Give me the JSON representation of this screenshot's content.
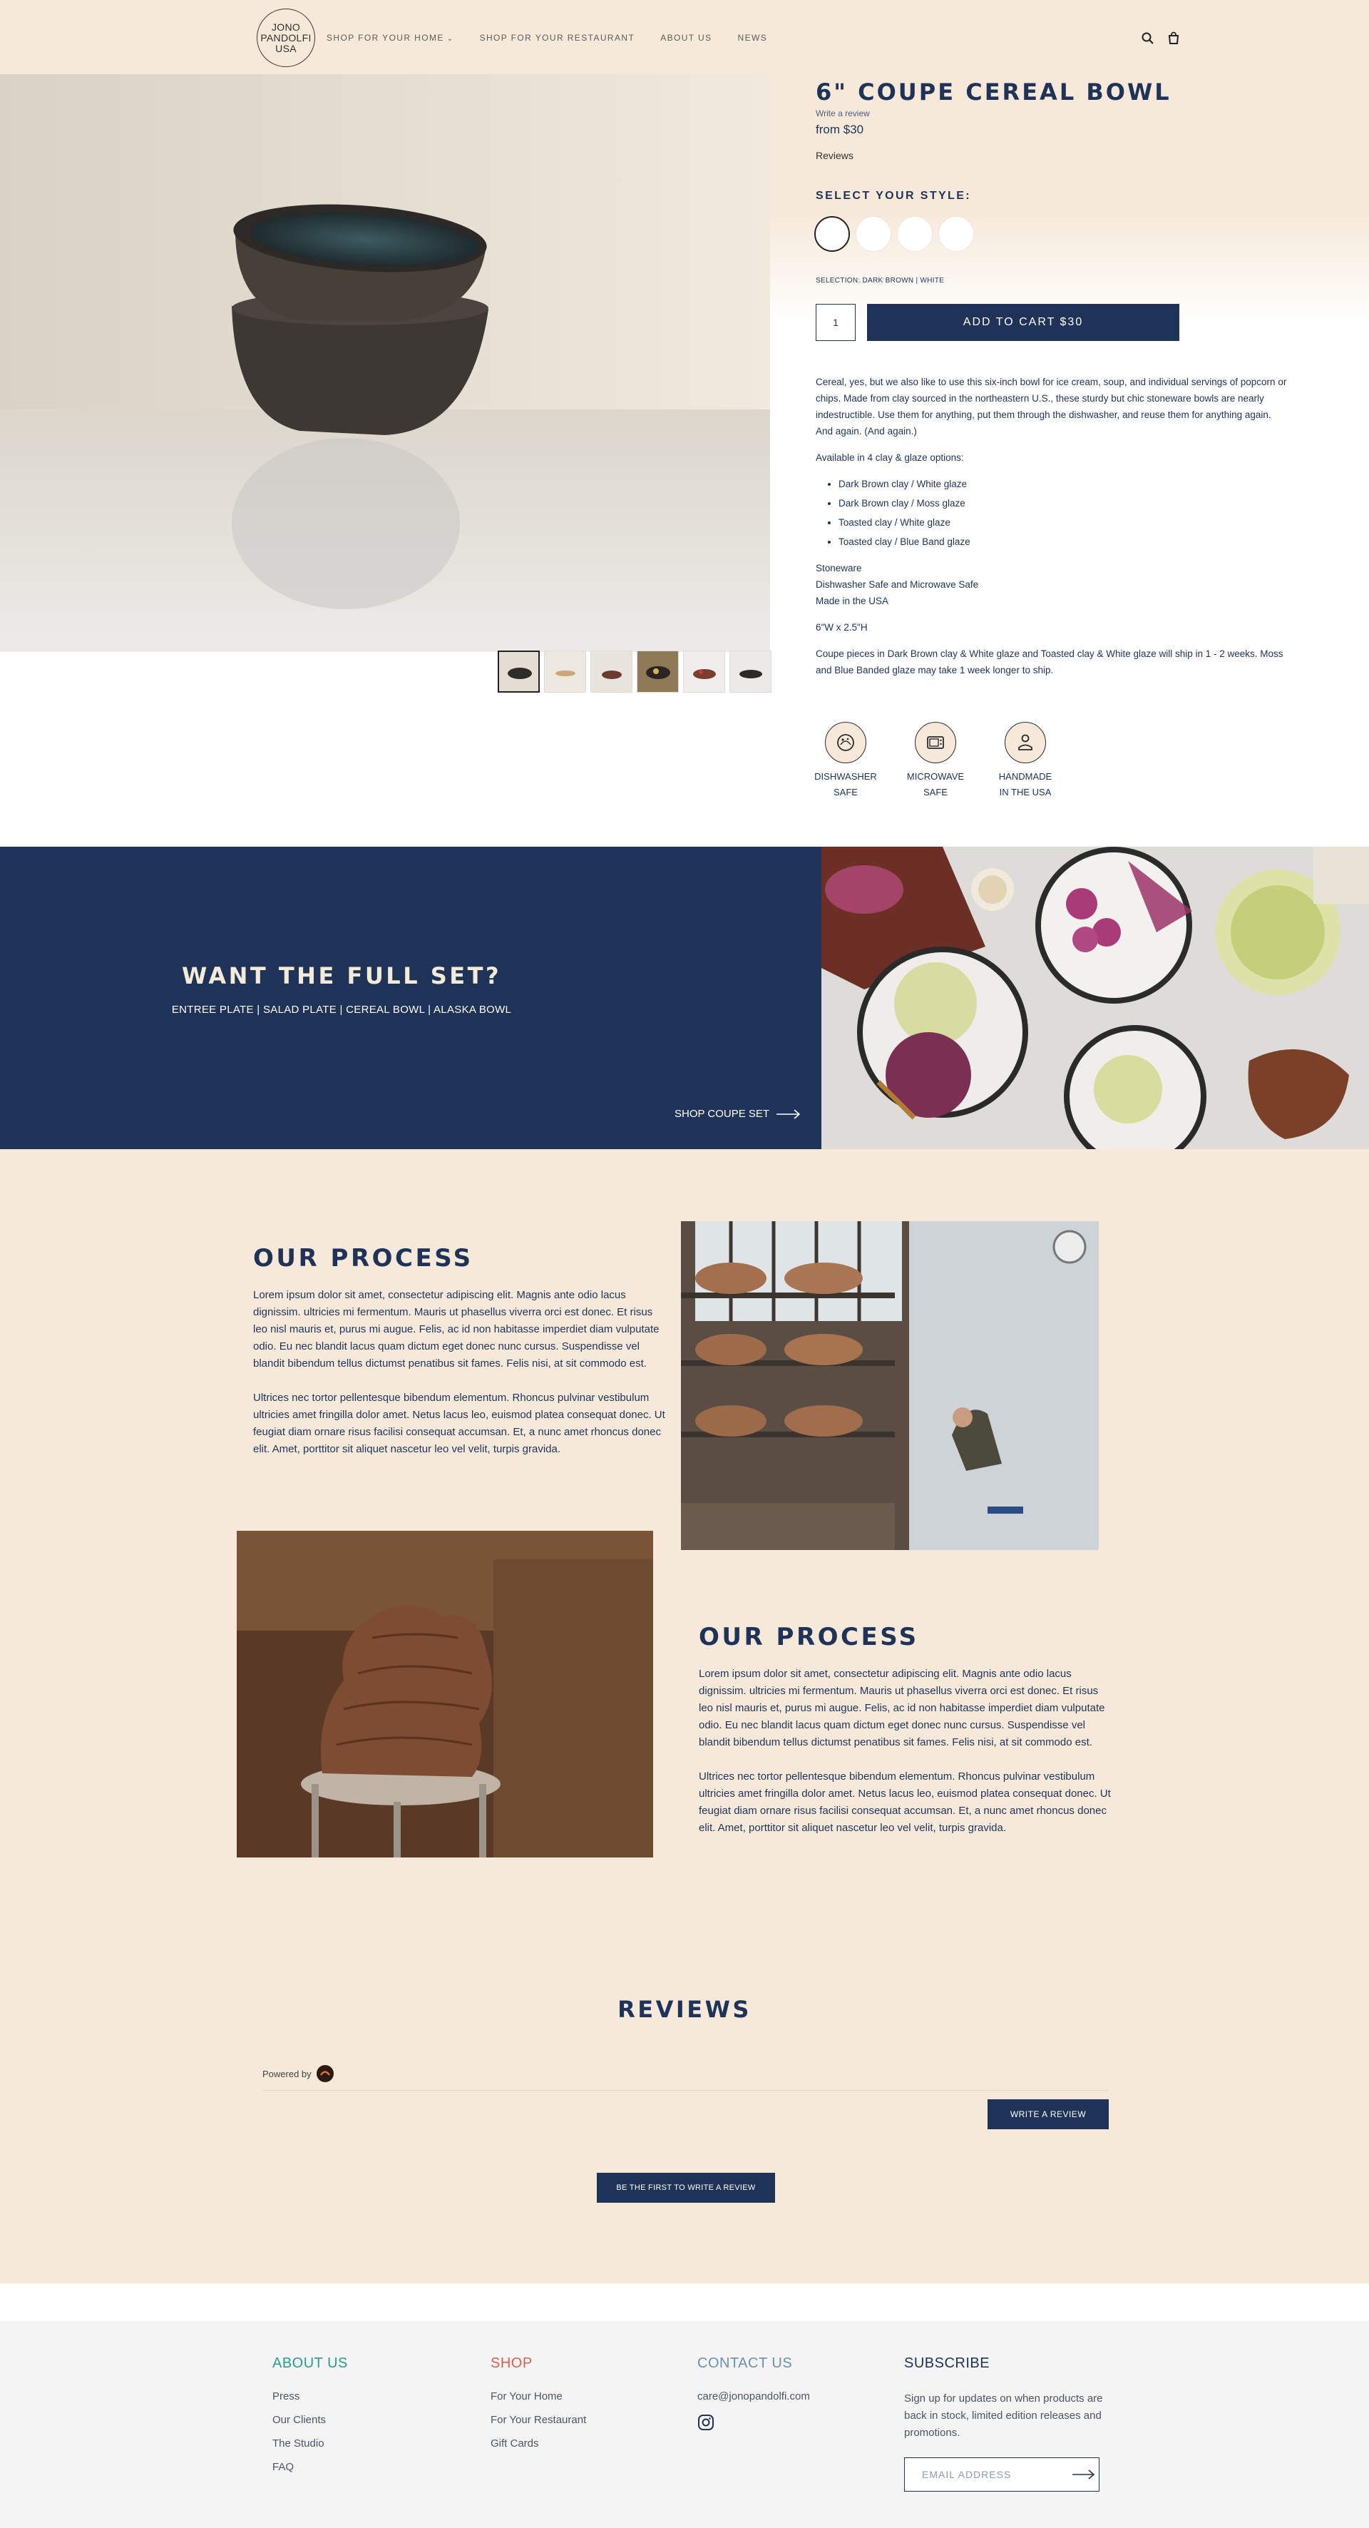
{
  "header": {
    "logo_lines": [
      "JONO",
      "PANDOLFI",
      "USA"
    ],
    "nav": [
      {
        "label": "SHOP FOR YOUR HOME",
        "has_dropdown": true
      },
      {
        "label": "SHOP FOR YOUR RESTAURANT"
      },
      {
        "label": "ABOUT US"
      },
      {
        "label": "NEWS"
      }
    ],
    "icons": [
      "search-icon",
      "cart-icon"
    ]
  },
  "product": {
    "title": "6\" COUPE CEREAL BOWL",
    "write_review": "Write a review",
    "price": "from $30",
    "reviews_label": "Reviews",
    "style_heading": "SELECT YOUR STYLE:",
    "selection": "SELECTION: DARK BROWN | WHITE",
    "quantity": "1",
    "add_to_cart": "ADD TO CART  $30",
    "description": "Cereal, yes, but we also like to use this six-inch bowl for ice cream, soup, and individual servings of popcorn or chips. Made from clay sourced in the northeastern U.S., these sturdy but chic stoneware bowls are nearly indestructible. Use them for anything, put them through the dishwasher, and reuse them for anything again. And again. (And again.)",
    "options_intro": "Available in 4 clay & glaze options:",
    "options": [
      "Dark Brown clay / White glaze",
      "Dark Brown clay / Moss glaze",
      "Toasted clay / White glaze",
      "Toasted clay / Blue Band glaze"
    ],
    "specs": [
      "Stoneware",
      "Dishwasher Safe and Microwave Safe",
      "Made in the USA"
    ],
    "dimensions": "6\"W x 2.5\"H",
    "shipping": "Coupe pieces in Dark Brown clay & White glaze and Toasted clay & White glaze will ship in 1 - 2 weeks. Moss and Blue Banded glaze may take 1 week longer to ship.",
    "features": [
      {
        "line1": "DISHWASHER",
        "line2": "SAFE"
      },
      {
        "line1": "MICROWAVE",
        "line2": "SAFE"
      },
      {
        "line1": "HANDMADE",
        "line2": "IN THE USA"
      }
    ]
  },
  "fullset": {
    "title": "WANT THE FULL SET?",
    "subtitle": "ENTREE PLATE | SALAD PLATE | CEREAL BOWL | ALASKA BOWL",
    "link": "SHOP COUPE SET"
  },
  "process": [
    {
      "heading": "OUR PROCESS",
      "p1": "Lorem ipsum dolor sit amet, consectetur adipiscing elit. Magnis ante odio lacus dignissim. ultricies mi fermentum. Mauris ut phasellus viverra orci est donec. Et risus leo nisl mauris et, purus mi augue. Felis, ac id non habitasse imperdiet diam vulputate odio. Eu nec blandit lacus quam dictum eget donec nunc cursus. Suspendisse vel blandit bibendum tellus dictumst penatibus sit fames. Felis nisi, at sit commodo est.",
      "p2": "Ultrices nec tortor pellentesque bibendum elementum. Rhoncus pulvinar vestibulum ultricies amet fringilla dolor amet. Netus lacus leo, euismod platea consequat donec. Ut feugiat diam ornare risus facilisi consequat accumsan. Et, a nunc amet rhoncus donec elit. Amet, porttitor sit aliquet nascetur leo vel velit, turpis gravida."
    },
    {
      "heading": "OUR PROCESS",
      "p1": "Lorem ipsum dolor sit amet, consectetur adipiscing elit. Magnis ante odio lacus dignissim. ultricies mi fermentum. Mauris ut phasellus viverra orci est donec. Et risus leo nisl mauris et, purus mi augue. Felis, ac id non habitasse imperdiet diam vulputate odio. Eu nec blandit lacus quam dictum eget donec nunc cursus. Suspendisse vel blandit bibendum tellus dictumst penatibus sit fames. Felis nisi, at sit commodo est.",
      "p2": "Ultrices nec tortor pellentesque bibendum elementum. Rhoncus pulvinar vestibulum ultricies amet fringilla dolor amet. Netus lacus leo, euismod platea consequat donec. Ut feugiat diam ornare risus facilisi consequat accumsan. Et, a nunc amet rhoncus donec elit. Amet, porttitor sit aliquet nascetur leo vel velit, turpis gravida."
    }
  ],
  "reviews": {
    "title": "REVIEWS",
    "powered_by": "Powered by",
    "write_review": "WRITE A REVIEW",
    "be_first": "BE THE FIRST TO WRITE A REVIEW"
  },
  "footer": {
    "about": {
      "heading": "ABOUT US",
      "links": [
        "Press",
        "Our Clients",
        "The Studio",
        "FAQ"
      ]
    },
    "shop": {
      "heading": "SHOP",
      "links": [
        "For Your Home",
        "For Your Restaurant",
        "Gift Cards"
      ]
    },
    "contact": {
      "heading": "CONTACT US",
      "email": "care@jonopandolfi.com"
    },
    "subscribe": {
      "heading": "SUBSCRIBE",
      "text": "Sign up for updates on when products are back in stock, limited edition releases and promotions.",
      "placeholder": "EMAIL ADDRESS"
    }
  },
  "colors": {
    "navy": "#1f3358",
    "cream": "#f6e9da",
    "about_teal": "#2a9d8f",
    "shop_red": "#d9604a",
    "contact_blue": "#6a8fb5",
    "subscribe": "#1f3358"
  }
}
